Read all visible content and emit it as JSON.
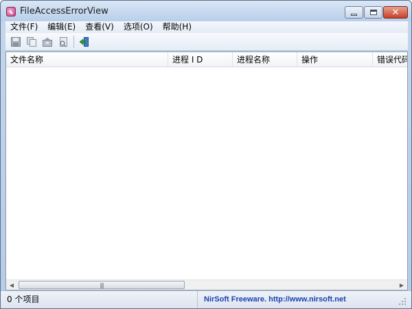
{
  "window": {
    "title": "FileAccessErrorView"
  },
  "menu": [
    {
      "label": "文件(F)"
    },
    {
      "label": "编辑(E)"
    },
    {
      "label": "查看(V)"
    },
    {
      "label": "选项(O)"
    },
    {
      "label": "帮助(H)"
    }
  ],
  "toolbar": {
    "icons": [
      "save-icon",
      "copy-icon",
      "properties-icon",
      "report-icon",
      "exit-icon"
    ]
  },
  "table": {
    "columns": [
      "文件名称",
      "进程 I D",
      "进程名称",
      "操作",
      "错误代码"
    ],
    "rows": []
  },
  "status": {
    "item_count": "0 个项目",
    "credit": "NirSoft Freeware.  http://www.nirsoft.net"
  },
  "colors": {
    "credit_text": "#1b3fb0",
    "close_button": "#c7402a"
  }
}
